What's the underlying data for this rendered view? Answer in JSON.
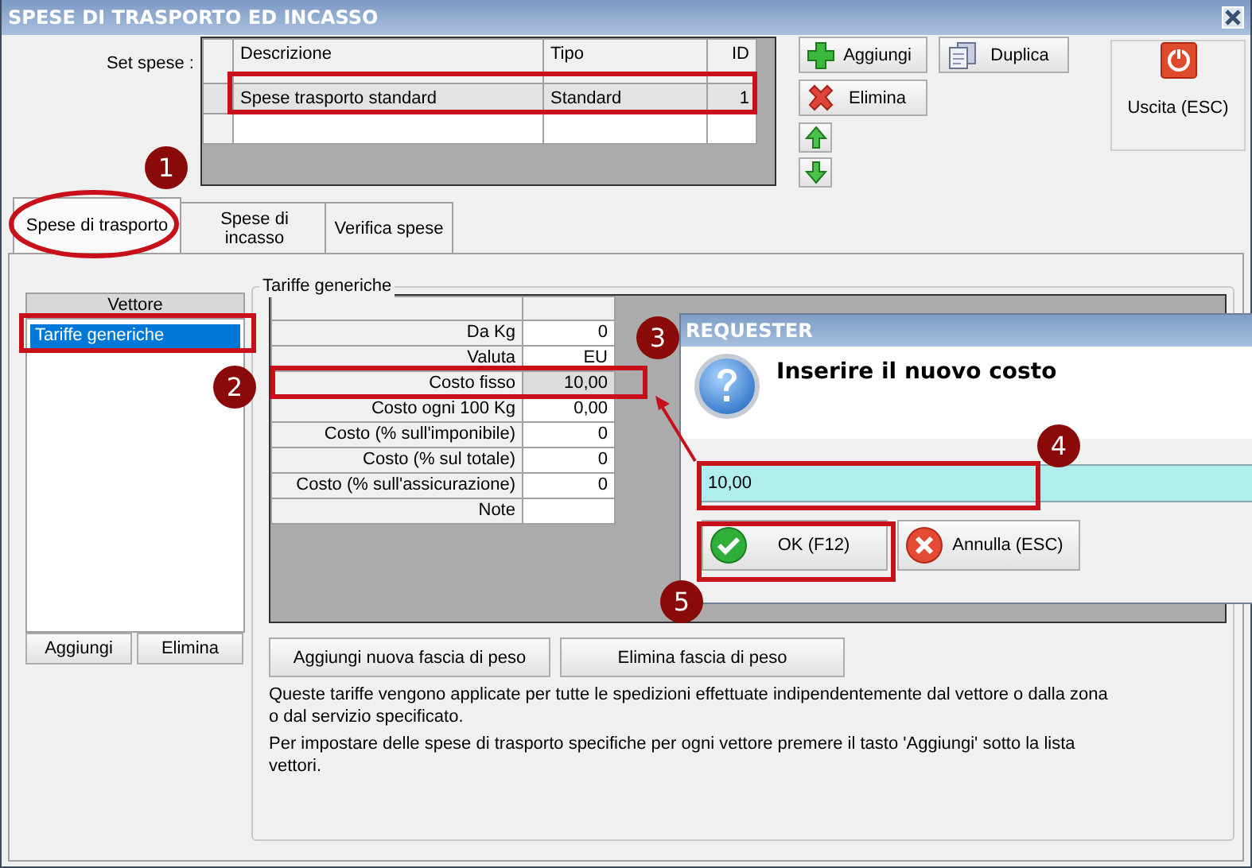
{
  "window": {
    "title": "SPESE DI TRASPORTO ED INCASSO"
  },
  "set_spese": {
    "label": "Set spese :",
    "columns": [
      "Descrizione",
      "Tipo",
      "ID"
    ],
    "rows": [
      {
        "descrizione": "Spese trasporto standard",
        "tipo": "Standard",
        "id": "1",
        "selected": true
      }
    ]
  },
  "top_buttons": [
    {
      "kind": "add",
      "label": "Aggiungi"
    },
    {
      "kind": "delete",
      "label": "Elimina"
    },
    {
      "kind": "up"
    },
    {
      "kind": "down"
    },
    {
      "kind": "duplicate",
      "label": "Duplica"
    },
    {
      "kind": "exit",
      "label": "Uscita (ESC)"
    }
  ],
  "tabs": [
    {
      "label": "Spese di trasporto",
      "selected": true
    },
    {
      "label": "Spese di incasso",
      "selected": false
    },
    {
      "label": "Verifica spese",
      "selected": false
    }
  ],
  "vettore": {
    "header": "Vettore",
    "items": [
      {
        "label": "Tariffe generiche",
        "selected": true
      }
    ],
    "buttons": [
      "Aggiungi",
      "Elimina"
    ]
  },
  "tariffe": {
    "title": "Tariffe generiche",
    "rows": [
      {
        "label": "Da Kg",
        "value": "0",
        "selected": false
      },
      {
        "label": "Valuta",
        "value": "EU",
        "selected": false
      },
      {
        "label": "Costo fisso",
        "value": "10,00",
        "selected": true
      },
      {
        "label": "Costo ogni 100 Kg",
        "value": "0,00",
        "selected": false
      },
      {
        "label": "Costo (% sull'imponibile)",
        "value": "0",
        "selected": false
      },
      {
        "label": "Costo (% sul totale)",
        "value": "0",
        "selected": false
      },
      {
        "label": "Costo (% sull'assicurazione)",
        "value": "0",
        "selected": false
      },
      {
        "label": "Note",
        "value": "",
        "selected": false
      }
    ],
    "buttons": [
      "Aggiungi nuova fascia di peso",
      "Elimina fascia di peso"
    ],
    "notes": [
      "Queste tariffe vengono applicate per tutte le spedizioni effettuate indipendentemente dal vettore o dalla zona o dal servizio specificato.",
      "Per impostare delle spese di trasporto specifiche per ogni vettore premere il tasto 'Aggiungi' sotto la lista vettori."
    ]
  },
  "dialog": {
    "title": "REQUESTER",
    "message": "Inserire il nuovo costo",
    "value": "10,00",
    "buttons": [
      {
        "kind": "ok",
        "label": "OK (F12)"
      },
      {
        "kind": "cancel",
        "label": "Annulla (ESC)"
      }
    ]
  },
  "annotations": [
    "1",
    "2",
    "3",
    "4",
    "5"
  ]
}
